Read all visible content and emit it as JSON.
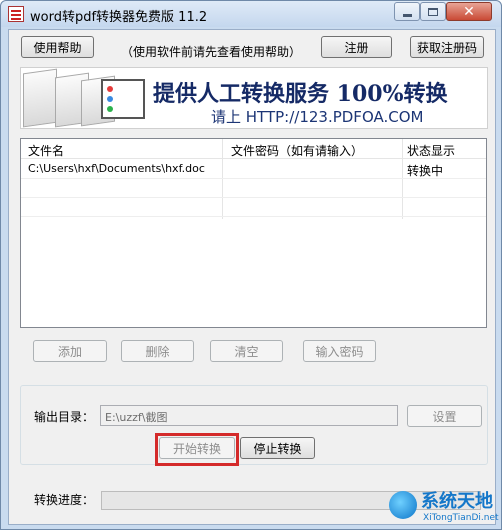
{
  "window": {
    "title": "word转pdf转换器免费版 11.2",
    "close_glyph": "✕"
  },
  "top_bar": {
    "help_button": "使用帮助",
    "hint": "（使用软件前请先查看使用帮助）",
    "register_button": "注册",
    "get_code_button": "获取注册码"
  },
  "banner": {
    "line1": "提供人工转换服务 100%转换",
    "line2": "请上  HTTP://123.PDFOA.COM"
  },
  "file_table": {
    "columns": [
      "文件名",
      "文件密码（如有请输入）",
      "状态显示"
    ],
    "rows": [
      {
        "filename": "C:\\Users\\hxf\\Documents\\hxf.doc",
        "password": "",
        "status": "转换中"
      }
    ]
  },
  "file_actions": {
    "add": "添加",
    "delete": "删除",
    "clear": "清空",
    "enter_password": "输入密码"
  },
  "output": {
    "label": "输出目录：",
    "path": "E:\\uzzf\\截图",
    "settings_button": "设置"
  },
  "conversion": {
    "start_button": "开始转换",
    "stop_button": "停止转换",
    "progress_label": "转换进度：",
    "progress_fraction": 0
  },
  "watermark": {
    "name": "系统天地",
    "site": "XiTongTianDi.net"
  },
  "colors": {
    "banner_text": "#152a66",
    "highlight_border": "#d42a2a",
    "watermark": "#1477c9"
  }
}
